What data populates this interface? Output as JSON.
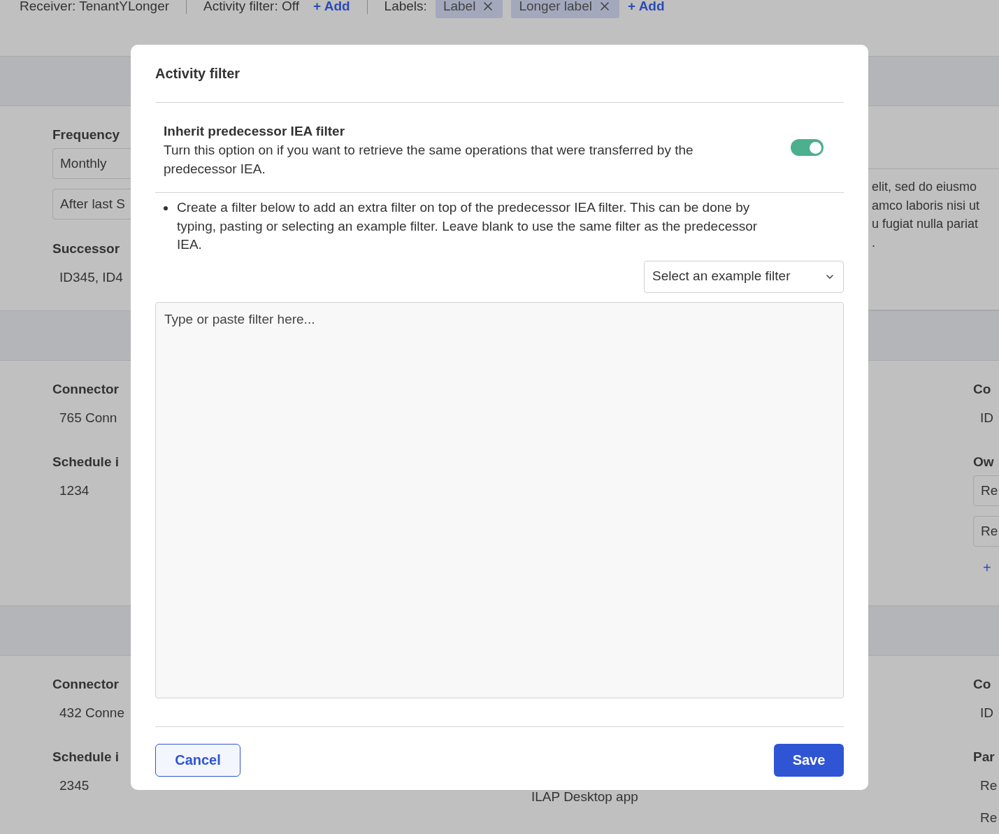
{
  "top_bar": {
    "receiver": "Receiver: TenantYLonger",
    "activity_filter": "Activity filter: Off",
    "add_filter": "+ Add",
    "labels_title": "Labels:",
    "labels": [
      "Label",
      "Longer label"
    ],
    "add_label": "+ Add"
  },
  "sections": [
    {
      "left": [
        {
          "kind": "label",
          "text": "Frequency"
        },
        {
          "kind": "field",
          "text": "Monthly"
        },
        {
          "kind": "field",
          "text": "After last S"
        },
        {
          "kind": "label",
          "text": "Successor"
        },
        {
          "kind": "value",
          "text": "ID345, ID4"
        }
      ],
      "right": [
        {
          "kind": "textbox",
          "lines": [
            "elit, sed do eiusmo",
            "amco laboris nisi ut",
            "u fugiat nulla pariat",
            "."
          ]
        }
      ]
    },
    {
      "left": [
        {
          "kind": "label",
          "text": "Connector"
        },
        {
          "kind": "value",
          "text": "765 Conn"
        },
        {
          "kind": "label",
          "text": "Schedule i"
        },
        {
          "kind": "value",
          "text": "1234"
        }
      ],
      "right": [
        {
          "kind": "label",
          "text": "Co"
        },
        {
          "kind": "value",
          "text": "ID"
        },
        {
          "kind": "label",
          "text": "Ow"
        },
        {
          "kind": "field",
          "text": "Re"
        },
        {
          "kind": "field",
          "text": "Re"
        },
        {
          "kind": "link",
          "text": "+"
        }
      ]
    },
    {
      "left": [
        {
          "kind": "label",
          "text": "Connector"
        },
        {
          "kind": "value",
          "text": "432 Conne"
        },
        {
          "kind": "label",
          "text": "Schedule i"
        },
        {
          "kind": "value",
          "text": "2345"
        }
      ],
      "middle": [
        {
          "kind": "value",
          "text": "ILAP Desktop app"
        }
      ],
      "right": [
        {
          "kind": "label",
          "text": "Co"
        },
        {
          "kind": "value",
          "text": "ID"
        },
        {
          "kind": "label",
          "text": "Par"
        },
        {
          "kind": "value",
          "text": "Re"
        },
        {
          "kind": "value",
          "text": "Re"
        }
      ]
    }
  ],
  "dialog": {
    "title": "Activity filter",
    "inherit": {
      "title": "Inherit predecessor IEA filter",
      "description": "Turn this option on if you want to retrieve the same operations that were transferred by the predecessor IEA.",
      "on": true
    },
    "bullets": [
      "Create a filter below to add an extra filter on top of the predecessor IEA filter. This can be done by typing, pasting or selecting an example filter. Leave blank to use the same filter as the predecessor IEA."
    ],
    "example_select": {
      "placeholder": "Select an example filter"
    },
    "filter_field": {
      "placeholder": "Type or paste filter here..."
    },
    "buttons": {
      "cancel": "Cancel",
      "save": "Save"
    }
  }
}
